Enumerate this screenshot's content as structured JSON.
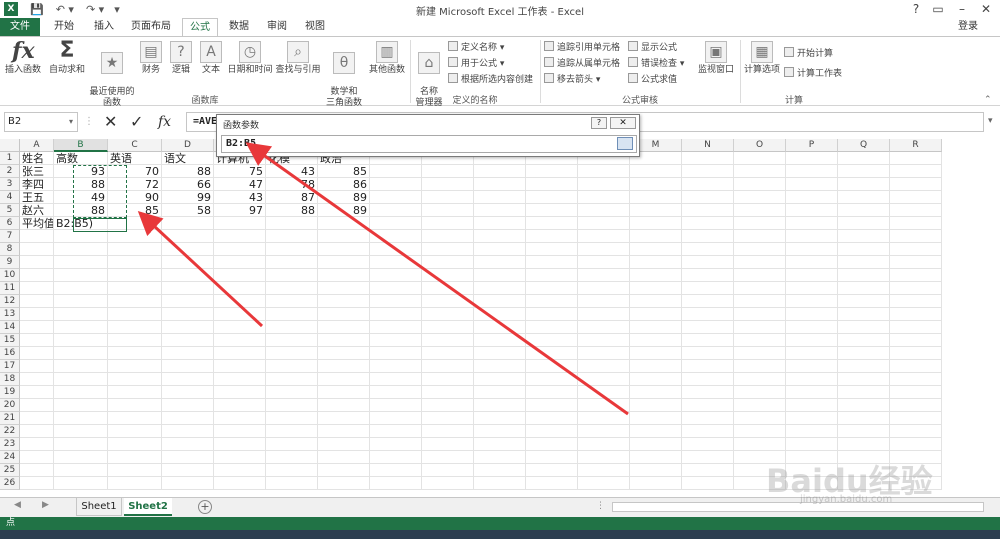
{
  "window": {
    "title": "新建 Microsoft Excel 工作表 - Excel",
    "login": "登录",
    "controls": [
      "?",
      "▭",
      "–",
      "□",
      "✕"
    ]
  },
  "tabs": [
    {
      "label": "文件"
    },
    {
      "label": "开始"
    },
    {
      "label": "插入"
    },
    {
      "label": "页面布局"
    },
    {
      "label": "公式"
    },
    {
      "label": "数据"
    },
    {
      "label": "审阅"
    },
    {
      "label": "视图"
    }
  ],
  "ribbon": {
    "insert_function": "插入函数",
    "autosum": "自动求和",
    "recent": "最近使用的\n函数",
    "finance": "财务",
    "logic": "逻辑",
    "text": "文本",
    "datetime": "日期和时间",
    "lookup": "查找与引用",
    "math": "数学和\n三角函数",
    "other": "其他函数",
    "name_mgr": "名称\n管理器",
    "define_name": "定义名称",
    "use_in_formula": "用于公式",
    "create_from_sel": "根据所选内容创建",
    "trace_precedents": "追踪引用单元格",
    "trace_dependents": "追踪从属单元格",
    "remove_arrows": "移去箭头",
    "show_formulas": "显示公式",
    "error_check": "错误检查",
    "eval_formula": "公式求值",
    "watch": "监视窗口",
    "calc_options": "计算选项",
    "calc_now": "开始计算",
    "calc_sheet": "计算工作表",
    "groups": {
      "library": "函数库",
      "defined_names": "定义的名称",
      "auditing": "公式审核",
      "calculation": "计算"
    }
  },
  "formula_bar": {
    "name_box": "B2",
    "formula": "=AVE"
  },
  "dialog": {
    "title": "函数参数",
    "input": "B2:B5",
    "help": "?"
  },
  "columns": [
    "A",
    "B",
    "C",
    "D",
    "E",
    "F",
    "G",
    "H",
    "I",
    "J",
    "K",
    "L",
    "M",
    "N",
    "O",
    "P",
    "Q",
    "R"
  ],
  "rows": [
    [
      "姓名",
      "高数",
      "英语",
      "语文",
      "计算机",
      "化模",
      "政治"
    ],
    [
      "张三",
      "93",
      "70",
      "88",
      "75",
      "43",
      "85"
    ],
    [
      "李四",
      "88",
      "72",
      "66",
      "47",
      "78",
      "86"
    ],
    [
      "王五",
      "49",
      "90",
      "99",
      "43",
      "87",
      "89"
    ],
    [
      "赵六",
      "88",
      "85",
      "58",
      "97",
      "88",
      "89"
    ],
    [
      "平均值",
      "B2:B5)",
      "",
      "",
      "",
      "",
      ""
    ]
  ],
  "row_numbers": [
    "1",
    "2",
    "3",
    "4",
    "5",
    "6",
    "7",
    "8",
    "9",
    "10",
    "11",
    "12",
    "13",
    "14",
    "15",
    "16",
    "17",
    "18",
    "19",
    "20",
    "21",
    "22",
    "23",
    "24",
    "25",
    "26"
  ],
  "sheets": [
    "Sheet1",
    "Sheet2"
  ],
  "active_sheet": "Sheet2",
  "status": {
    "mode": "点"
  },
  "watermark": {
    "logo": "Baidu经验",
    "url": "jingyan.baidu.com"
  },
  "colors": {
    "accent": "#217346",
    "arrow": "#e8383a"
  }
}
